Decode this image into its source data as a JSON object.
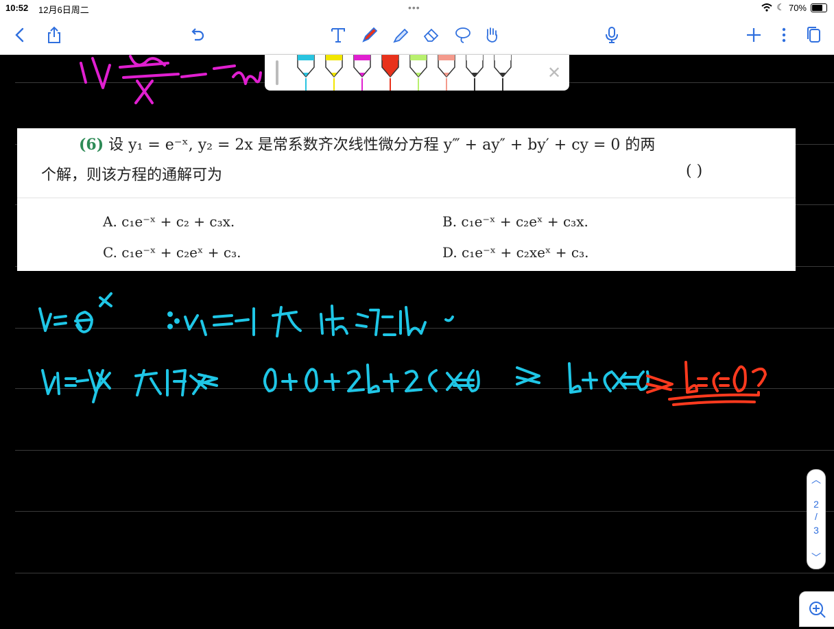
{
  "status": {
    "time": "10:52",
    "date": "12月6日周二",
    "battery": "70%",
    "battery_level": 0.7
  },
  "toolbar": {
    "icons": [
      "back-icon",
      "share-icon",
      "undo-icon",
      "text-tool-icon",
      "pen-icon",
      "highlighter-icon",
      "eraser-icon",
      "lasso-icon",
      "hand-icon",
      "microphone-icon",
      "add-icon",
      "more-icon",
      "pages-icon"
    ]
  },
  "palette": {
    "pens": [
      {
        "color": "#29c4e0"
      },
      {
        "color": "#f2e600"
      },
      {
        "color": "#e020d0"
      },
      {
        "color": "#e8321c"
      },
      {
        "color": "#b8f06e"
      },
      {
        "color": "#f49a8c"
      },
      {
        "color": "#ffffff"
      },
      {
        "color": "#ffffff"
      }
    ]
  },
  "problem": {
    "number": "(6)",
    "line1_text": "设 y₁ = e⁻ˣ, y₂ = 2x 是常系数齐次线性微分方程 y‴ + ay″ + by′ + cy = 0 的两",
    "line2_text": "个解，则该方程的通解可为",
    "bracket": "(        )",
    "options": {
      "a": "A. c₁e⁻ˣ + c₂ + c₃x.",
      "b": "B. c₁e⁻ˣ + c₂eˣ + c₃x.",
      "c": "C. c₁e⁻ˣ + c₂eˣ + c₃.",
      "d": "D. c₁e⁻ˣ + c₂xeˣ + c₃."
    }
  },
  "pagination": {
    "current": "2",
    "separator": "/",
    "total": "3"
  },
  "colors": {
    "ink_blue": "#1fc6e6",
    "ink_red": "#ff3a1e",
    "ink_magenta": "#e01fd0"
  }
}
